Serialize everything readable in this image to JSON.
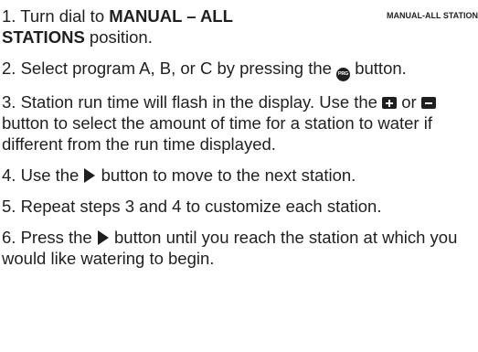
{
  "corner_label": "MANUAL-ALL STATION",
  "icons": {
    "program_button": "prg-button-icon",
    "plus_button": "plus-button-icon",
    "minus_button": "minus-button-icon",
    "next_arrow_button": "right-arrow-button-icon",
    "prg_text": "PRG"
  },
  "steps": [
    {
      "num": "1.",
      "pre": "Turn dial to ",
      "bold": "MANUAL – ALL STATIONS",
      "post": " position."
    },
    {
      "num": "2.",
      "pre": "Select program A, B, or C by pressing the ",
      "post": " button."
    },
    {
      "num": "3.",
      "pre": "Station run time will flash in the display. Use the ",
      "mid": " or ",
      "post": " button to select the amount of time for a station to water if different from the run time displayed."
    },
    {
      "num": "4.",
      "pre": "Use the ",
      "post": " button to move to the next station."
    },
    {
      "num": "5.",
      "text": "Repeat steps 3 and 4 to customize each station."
    },
    {
      "num": "6.",
      "pre": "Press the ",
      "post": " button until you reach the station at which you would like watering to begin."
    }
  ]
}
